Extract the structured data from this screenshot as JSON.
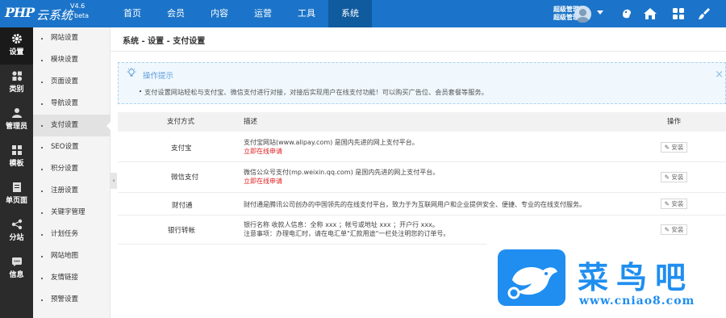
{
  "header": {
    "logo_php": "PHP",
    "logo_cn": "云系统",
    "version": "V4.6",
    "beta": "beta",
    "nav": [
      "首页",
      "会员",
      "内容",
      "运营",
      "工具",
      "系统"
    ],
    "active_nav": "系统",
    "user_line1": "超级管理员",
    "user_line2": "超级管理员"
  },
  "sidebar": {
    "primary": [
      "设置",
      "类别",
      "管理员",
      "模板",
      "单页面",
      "分站",
      "信息"
    ],
    "active_primary": "设置",
    "secondary": [
      "网站设置",
      "模块设置",
      "页面设置",
      "导航设置",
      "支付设置",
      "SEO设置",
      "积分设置",
      "注册设置",
      "关键字管理",
      "计划任务",
      "网站地图",
      "友情链接",
      "预警设置"
    ],
    "active_secondary": "支付设置"
  },
  "breadcrumb": "系统 - 设置 - 支付设置",
  "tips": {
    "title": "操作提示",
    "text": "支付设置网站轻松与支付宝、微信支付进行对接，对接后实现用户在线支付功能！可以购买广告位、会员套餐等服务。"
  },
  "table": {
    "headers": {
      "method": "支付方式",
      "desc": "描述",
      "action": "操作"
    },
    "rows": [
      {
        "name": "支付宝",
        "desc": [
          "支付宝网站(www.alipay.com) 是国内先进的网上支付平台。"
        ],
        "link": "立即在线申请",
        "action": "安装"
      },
      {
        "name": "微信支付",
        "desc": [
          "微信公众号支付(mp.weixin.qq.com) 是国内先进的网上支付平台。"
        ],
        "link": "立即在线申请",
        "action": "安装"
      },
      {
        "name": "财付通",
        "desc": [
          "财付通是腾讯公司创办的中国领先的在线支付平台，致力于为互联网用户和企业提供安全、便捷、专业的在线支付服务。"
        ],
        "link": "",
        "action": "安装"
      },
      {
        "name": "银行转帐",
        "desc": [
          "银行名称 收款人信息：全称 xxx ；帐号或地址 xxx ；开户行 xxx。",
          "注意事项：办理电汇时，请在电汇单\"汇款用途\"一栏处注明您的订单号。"
        ],
        "link": "",
        "action": "安装"
      }
    ]
  },
  "watermark": {
    "cn": "菜鸟吧",
    "url": "www.cniao8.com"
  },
  "colors": {
    "topbar": "#1b74c9",
    "topbar_active": "#105a9e",
    "sidebar_dark": "#2b2b2b",
    "link_red": "#e02020",
    "watermark_blue": "#1f8ef0"
  }
}
